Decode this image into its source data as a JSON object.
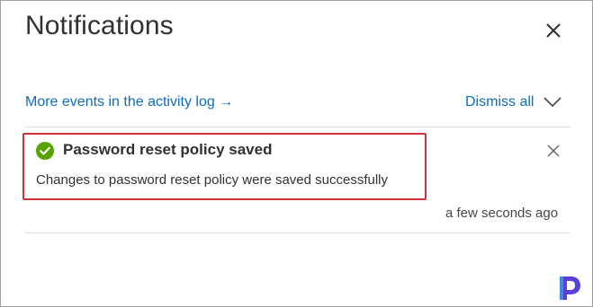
{
  "panel": {
    "title": "Notifications",
    "activity_link": "More events in the activity log →",
    "dismiss_all": "Dismiss all"
  },
  "notification": {
    "title": "Password reset policy saved",
    "message": "Changes to password reset policy were saved successfully",
    "timestamp": "a few seconds ago",
    "status": "success"
  },
  "icons": {
    "close": "close-icon",
    "chevron": "chevron-down-icon",
    "success": "checkmark-circle-icon",
    "logo": "brand-logo"
  },
  "colors": {
    "link": "#0f6cbd",
    "success": "#57a300",
    "highlight": "#d13438",
    "logo_primary": "#5b3fd6"
  }
}
